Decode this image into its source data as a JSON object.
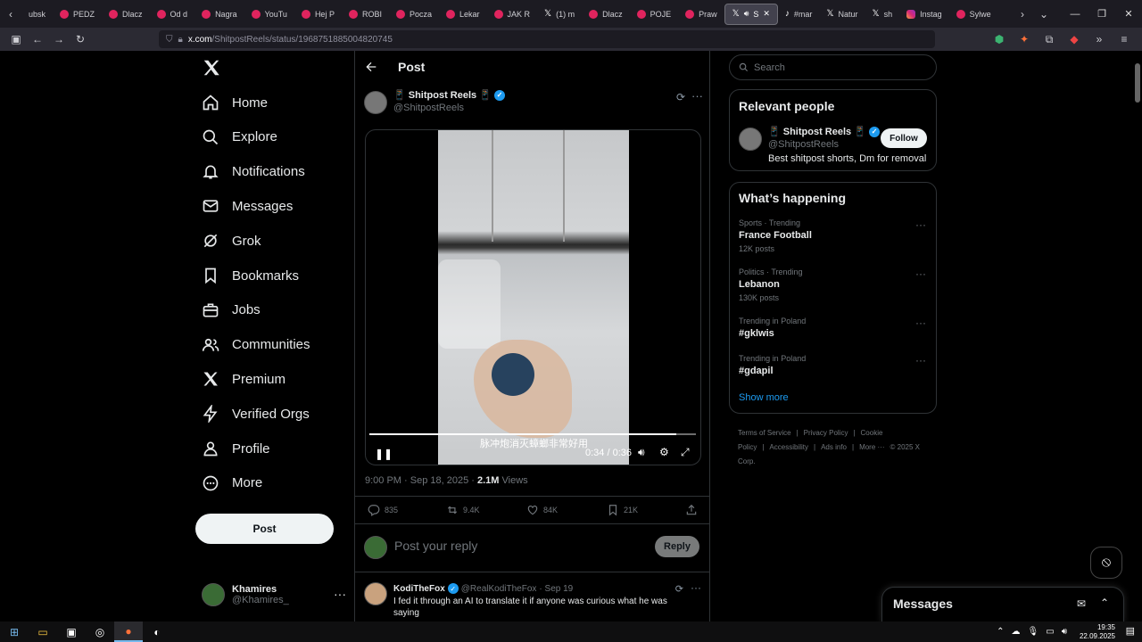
{
  "browser": {
    "tabs": [
      {
        "label": "ubsk",
        "icon": "none"
      },
      {
        "label": "PEDZ",
        "icon": "youtube"
      },
      {
        "label": "Dlacz",
        "icon": "youtube"
      },
      {
        "label": "Od d",
        "icon": "youtube"
      },
      {
        "label": "Nagra",
        "icon": "youtube"
      },
      {
        "label": "YouTu",
        "icon": "youtube"
      },
      {
        "label": "Hej P",
        "icon": "youtube"
      },
      {
        "label": "ROBI",
        "icon": "youtube"
      },
      {
        "label": "Pocza",
        "icon": "youtube"
      },
      {
        "label": "Lekar",
        "icon": "youtube"
      },
      {
        "label": "JAK R",
        "icon": "youtube"
      },
      {
        "label": "(1) m",
        "icon": "x"
      },
      {
        "label": "Dlacz",
        "icon": "youtube"
      },
      {
        "label": "POJE",
        "icon": "youtube"
      },
      {
        "label": "Praw",
        "icon": "youtube"
      },
      {
        "label": "S",
        "icon": "x",
        "active": true
      },
      {
        "label": "#mar",
        "icon": "tiktok"
      },
      {
        "label": "Natur",
        "icon": "x"
      },
      {
        "label": "sh",
        "icon": "x"
      },
      {
        "label": "Instag",
        "icon": "instagram"
      },
      {
        "label": "Sylwe",
        "icon": "youtube"
      }
    ],
    "url_host": "x.com",
    "url_path": "/ShitpostReels/status/1968751885004820745"
  },
  "sidebar": {
    "items": [
      {
        "label": "Home",
        "icon": "home-icon"
      },
      {
        "label": "Explore",
        "icon": "search-icon"
      },
      {
        "label": "Notifications",
        "icon": "bell-icon"
      },
      {
        "label": "Messages",
        "icon": "mail-icon"
      },
      {
        "label": "Grok",
        "icon": "grok-icon"
      },
      {
        "label": "Bookmarks",
        "icon": "bookmark-icon"
      },
      {
        "label": "Jobs",
        "icon": "briefcase-icon"
      },
      {
        "label": "Communities",
        "icon": "people-icon"
      },
      {
        "label": "Premium",
        "icon": "x-logo-icon"
      },
      {
        "label": "Verified Orgs",
        "icon": "lightning-icon"
      },
      {
        "label": "Profile",
        "icon": "person-icon"
      },
      {
        "label": "More",
        "icon": "more-circle-icon"
      }
    ],
    "post_label": "Post",
    "account": {
      "name": "Khamires",
      "handle": "@Khamires_"
    }
  },
  "post": {
    "header_title": "Post",
    "author_name": "📱 Shitpost Reels 📱",
    "author_handle": "@ShitpostReels",
    "video": {
      "subtitle": "脉冲炮消灭蟑螂非常好用",
      "time": "0:34 / 0:36",
      "progress": 0.94
    },
    "timestamp": "9:00 PM · Sep 18, 2025 · ",
    "views_count": "2.1M",
    "views_label": " Views",
    "stats": {
      "replies": "835",
      "reposts": "9.4K",
      "likes": "84K",
      "bookmarks": "21K"
    },
    "reply_placeholder": "Post your reply",
    "reply_button": "Reply"
  },
  "comment": {
    "name": "KodiTheFox",
    "handle": "@RealKodiTheFox",
    "date": "· Sep 19",
    "text": "I fed it through an AI to translate it if anyone was curious what he was saying"
  },
  "right": {
    "search_placeholder": "Search",
    "relevant_title": "Relevant people",
    "relevant": {
      "name": "📱 Shitpost Reels 📱",
      "handle": "@ShitpostReels",
      "bio": "Best shitpost shorts, Dm for removal",
      "follow": "Follow"
    },
    "happening_title": "What’s happening",
    "trends": [
      {
        "context": "Sports · Trending",
        "title": "France Football",
        "count": "12K posts"
      },
      {
        "context": "Politics · Trending",
        "title": "Lebanon",
        "count": "130K posts"
      },
      {
        "context": "Trending in Poland",
        "title": "#gklwis",
        "count": ""
      },
      {
        "context": "Trending in Poland",
        "title": "#gdapil",
        "count": ""
      }
    ],
    "show_more": "Show more",
    "footer": [
      "Terms of Service",
      "|",
      "Privacy Policy",
      "|",
      "Cookie Policy",
      "|",
      "Accessibility",
      "|",
      "Ads info",
      "|",
      "More ···",
      "© 2025 X Corp."
    ]
  },
  "messages_bar": {
    "title": "Messages"
  },
  "taskbar": {
    "time": "19:35",
    "date": "22.09.2025"
  },
  "colors": {
    "accent": "#1d9bf0",
    "bg": "#000000",
    "border": "#2f3336",
    "muted": "#71767b"
  }
}
